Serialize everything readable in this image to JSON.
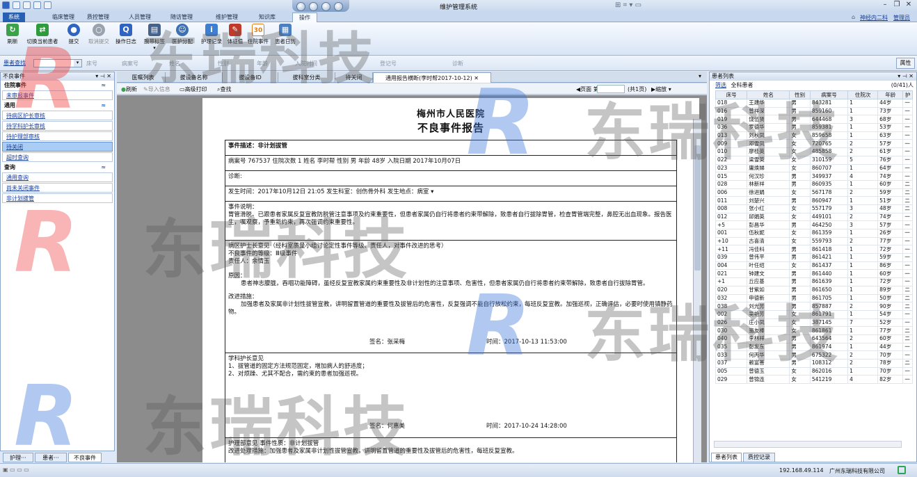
{
  "window": {
    "title": "维护管理系统",
    "user_dept": "神经内二科",
    "user_name": "管理员"
  },
  "menu_tabs": [
    "系统",
    "临床管理",
    "质控管理",
    "人员管理",
    "随访管理",
    "维护管理",
    "知识库",
    "操作"
  ],
  "ribbon": [
    {
      "label": "刷新",
      "icon": "refresh-icon",
      "color": "#3aa24a"
    },
    {
      "label": "切换当前患者",
      "icon": "switch-patient-icon",
      "color": "#2e9b3c"
    },
    {
      "label": "提交",
      "icon": "submit-icon",
      "color": "#2f64c2"
    },
    {
      "label": "取消提交",
      "icon": "cancel-submit-icon",
      "color": "#9aa3ad"
    },
    {
      "label": "操作日志",
      "icon": "operation-log-icon",
      "color": "#2f64c2"
    },
    {
      "label": "腕带标签",
      "icon": "wristband-printer-icon",
      "color": "#47628a"
    },
    {
      "label": "医护分配",
      "icon": "staff-assign-icon",
      "color": "#3d6fb3"
    },
    {
      "label": "护理记录",
      "icon": "nursing-record-icon",
      "color": "#3f7fd1"
    },
    {
      "label": "体征值",
      "icon": "vital-signs-icon",
      "color": "#c0392b"
    },
    {
      "label": "住院事件",
      "icon": "calendar-30-icon",
      "color": "#e07b1a"
    },
    {
      "label": "患者日历",
      "icon": "patient-calendar-icon",
      "color": "#4a7fc1"
    }
  ],
  "search_bar": {
    "label": "患者查找",
    "fields": [
      "床号",
      "病案号",
      "姓名",
      "性别",
      "年龄",
      "入院时间",
      "登记号",
      "诊断"
    ],
    "properties": "属性"
  },
  "left_panel": {
    "title": "不良事件",
    "groups": [
      {
        "name": "住院事件",
        "items": [
          "未审报事件"
        ]
      },
      {
        "name": "通用",
        "items": [
          "待病区护长审核",
          "待学科护长审核",
          "待护理部审核",
          "待关闭",
          "超时查询"
        ]
      },
      {
        "name": "查询",
        "items": [
          "通用查询",
          "尚未关闭事件",
          "非计划拔管"
        ]
      }
    ],
    "bottom_tabs": [
      "护理···",
      "患者···",
      "不良事件"
    ]
  },
  "doc_tabs": [
    "医嘱列表",
    "拔设备名称",
    "拔设备ID",
    "拔科室分类",
    "待关闭",
    "通用报告横断(李时帮2017-10-12)"
  ],
  "doc_toolbar": {
    "refresh": "刷新",
    "import": "导入信息",
    "print": "高级打印",
    "find": "查找",
    "page": "页面 第1页",
    "total": "(共1页)",
    "zoom": "缩放"
  },
  "report": {
    "hospital": "梅州市人民医院",
    "title": "不良事件报告",
    "event_desc": "事件描述：非计划拔管",
    "patient_line": "病案号 767537    住院次数 1    姓名 李时帮    性别 男    年龄 48岁  入院日期 2017年10月07日",
    "diagnosis": "诊断:",
    "occur_line": "发生时间：2017年10月12日 21:05  发生科室：创伤骨外科  发生地点：病室",
    "desc_label": "事件说明：",
    "desc_text": "胃管滑脱。已跟患者家属反复宣教防脱管注意事项及约束重要性，但患者家属仍自行将患者约束带解除，致患者自行拔除胃管，检查胃管端完整，鼻腔无出血现象。报告医生，嘱观察，予重新约束，再次强调约束重要性。",
    "ward_label": "病区护士长意见（经科室质量小组讨论定性事件等级、责任人，对事件改进的思考）",
    "level": "不良事件的等级：Ⅲ级事件",
    "responsible": "责任人：余情玉",
    "cause_label": "原因：",
    "cause_text": "患者神志朦胧，吞咽功能障碍，虽经反复宣教家属约束重要性及非计划性的注意事项、危害性，但患者家属仍自行将患者约束带解除，致患者自行拔除胃管。",
    "improve_label": "改进措施：",
    "improve_text": "加强患者及家属非计划性拔管宣教，讲明留置管道的重要性及拔管后的危害性，反复强调不能自行放松约束，每班反复宣教。加强巡视，正确评估，必要时使用镇静药物。",
    "sign1": "签名：张采梅",
    "time1": "时间：2017-10-13 11:53:00",
    "subject_label": "学科护长意见",
    "subject_1": "1、拔管道的固定方法规范固定，增加病人的舒适度；",
    "subject_2": "2、对烦躁、尤其不配合，需约束的患者加强巡视。",
    "sign2": "签名：何惠美",
    "time2": "时间：2017-10-24 14:28:00",
    "dept_line": "护理部意见   事件性质：非计划拔管",
    "dept_text": "改进处理措施：加强患者及家属非计划性拔管宣教，讲明留置管道的重要性及拔管后的危害性，每班反复宣教。"
  },
  "right_panel": {
    "title": "患者列表",
    "filter": "筛选",
    "scope": "全科患者",
    "count": "(0/41)人",
    "columns": [
      "床号",
      "姓名",
      "性别",
      "病案号",
      "住院次",
      "年龄",
      "护"
    ],
    "rows": [
      [
        "018",
        "王建华",
        "男",
        "843281",
        "1",
        "44岁",
        "一"
      ],
      [
        "016",
        "曾祥深",
        "男",
        "859160",
        "1",
        "73岁",
        "一"
      ],
      [
        "019",
        "饶伍贤",
        "男",
        "644468",
        "3",
        "68岁",
        "一"
      ],
      [
        "036",
        "罗德华",
        "男",
        "859381",
        "1",
        "53岁",
        "一"
      ],
      [
        "013",
        "刘秋凤",
        "女",
        "859658",
        "1",
        "63岁",
        "一"
      ],
      [
        "009",
        "邓雪凤",
        "女",
        "720765",
        "2",
        "57岁",
        "一"
      ],
      [
        "010",
        "廖桂英",
        "女",
        "485858",
        "2",
        "61岁",
        "一"
      ],
      [
        "022",
        "梁雪英",
        "女",
        "310159",
        "5",
        "76岁",
        "一"
      ],
      [
        "023",
        "庸焕娣",
        "女",
        "860707",
        "1",
        "64岁",
        "一"
      ],
      [
        "015",
        "何汉珍",
        "男",
        "349937",
        "4",
        "74岁",
        "一"
      ],
      [
        "028",
        "林新祥",
        "男",
        "860935",
        "1",
        "60岁",
        "二"
      ],
      [
        "006",
        "徐进娟",
        "女",
        "567178",
        "2",
        "59岁",
        "二"
      ],
      [
        "011",
        "刘楚兴",
        "男",
        "860947",
        "1",
        "51岁",
        "二"
      ],
      [
        "008",
        "张小红",
        "女",
        "557179",
        "3",
        "48岁",
        "二"
      ],
      [
        "012",
        "邱娟英",
        "女",
        "449101",
        "2",
        "74岁",
        "一"
      ],
      [
        "+5",
        "彭昌华",
        "男",
        "464250",
        "3",
        "57岁",
        "一"
      ],
      [
        "001",
        "伍秋妮",
        "女",
        "861359",
        "1",
        "26岁",
        "一"
      ],
      [
        "+10",
        "古喜清",
        "女",
        "559793",
        "2",
        "77岁",
        "一"
      ],
      [
        "+11",
        "冯佳科",
        "男",
        "861418",
        "1",
        "72岁",
        "一"
      ],
      [
        "039",
        "曾伟平",
        "男",
        "861421",
        "1",
        "59岁",
        "一"
      ],
      [
        "004",
        "叶任绍",
        "女",
        "861437",
        "1",
        "86岁",
        "一"
      ],
      [
        "021",
        "钟建文",
        "男",
        "861440",
        "1",
        "60岁",
        "一"
      ],
      [
        "+1",
        "丘应基",
        "男",
        "861639",
        "1",
        "72岁",
        "一"
      ],
      [
        "020",
        "甘紫如",
        "男",
        "861650",
        "1",
        "89岁",
        "二"
      ],
      [
        "032",
        "申德新",
        "男",
        "861705",
        "1",
        "50岁",
        "二"
      ],
      [
        "038",
        "刘光芳",
        "男",
        "857887",
        "2",
        "90岁",
        "二"
      ],
      [
        "002",
        "吴艳芳",
        "女",
        "861791",
        "1",
        "54岁",
        "一"
      ],
      [
        "026",
        "庄小凤",
        "女",
        "387145",
        "7",
        "52岁",
        "一"
      ],
      [
        "030",
        "骆友棒",
        "女",
        "861861",
        "1",
        "77岁",
        "二"
      ],
      [
        "040",
        "李林祥",
        "男",
        "643564",
        "2",
        "60岁",
        "二"
      ],
      [
        "035",
        "彭发东",
        "男",
        "861974",
        "1",
        "44岁",
        "一"
      ],
      [
        "033",
        "何丙华",
        "男",
        "675322",
        "2",
        "70岁",
        "一"
      ],
      [
        "037",
        "赖富善",
        "男",
        "108312",
        "2",
        "78岁",
        "二"
      ],
      [
        "005",
        "曾德玉",
        "女",
        "862016",
        "1",
        "70岁",
        "一"
      ],
      [
        "029",
        "曾锦连",
        "女",
        "541219",
        "4",
        "82岁",
        "一"
      ]
    ],
    "bottom_tabs": [
      "患者列表",
      "质控记录"
    ]
  },
  "status_bar": {
    "ip": "192.168.49.114",
    "company": "广州东瑞科技有限公司"
  },
  "watermark": {
    "text": "东瑞科技",
    "logo": "R"
  }
}
